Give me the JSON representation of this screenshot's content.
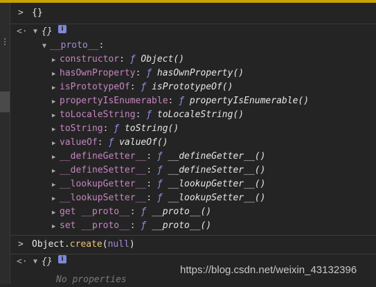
{
  "console": {
    "entries": [
      {
        "result": "{}"
      },
      {
        "object_label": "{}"
      },
      {
        "proto_label": "__proto__"
      },
      {
        "props": [
          {
            "key": "constructor",
            "value": "Object()"
          },
          {
            "key": "hasOwnProperty",
            "value": "hasOwnProperty()"
          },
          {
            "key": "isPrototypeOf",
            "value": "isPrototypeOf()"
          },
          {
            "key": "propertyIsEnumerable",
            "value": "propertyIsEnumerable()"
          },
          {
            "key": "toLocaleString",
            "value": "toLocaleString()"
          },
          {
            "key": "toString",
            "value": "toString()"
          },
          {
            "key": "valueOf",
            "value": "valueOf()"
          },
          {
            "key": "__defineGetter__",
            "value": "__defineGetter__()"
          },
          {
            "key": "__defineSetter__",
            "value": "__defineSetter__()"
          },
          {
            "key": "__lookupGetter__",
            "value": "__lookupGetter__()"
          },
          {
            "key": "__lookupSetter__",
            "value": "__lookupSetter__()"
          },
          {
            "key": "get __proto__",
            "value": "__proto__()"
          },
          {
            "key": "set __proto__",
            "value": "__proto__()"
          }
        ]
      }
    ],
    "fn_glyph": "ƒ",
    "info_glyph": "i",
    "input": {
      "object": "Object",
      "dot": ".",
      "method": "create",
      "open": "(",
      "arg": "null",
      "close": ")"
    },
    "result2": {
      "object_label": "{}",
      "empty_text": "No properties"
    }
  },
  "watermark": "https://blog.csdn.net/weixin_43132396",
  "icons": {
    "prompt": "chevron-right-icon",
    "back": "back-arrow-icon",
    "expand": "triangle-down-icon",
    "collapse": "triangle-right-icon",
    "info": "info-icon"
  }
}
